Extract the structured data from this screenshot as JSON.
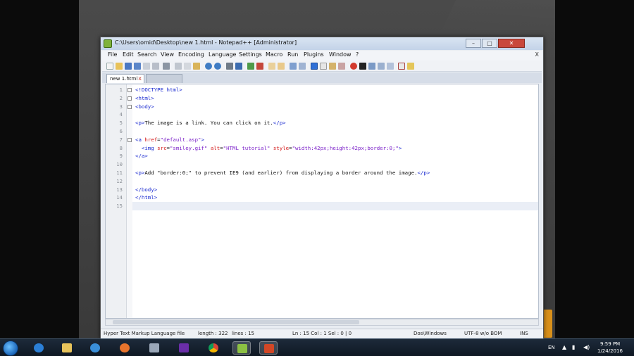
{
  "window": {
    "title": "C:\\Users\\omid\\Desktop\\new 1.html - Notepad++ [Administrator]",
    "controls": {
      "minimize": "–",
      "maximize": "□",
      "close": "✕"
    }
  },
  "menu": {
    "items": [
      "File",
      "Edit",
      "Search",
      "View",
      "Encoding",
      "Language",
      "Settings",
      "Macro",
      "Run",
      "Plugins",
      "Window",
      "?"
    ],
    "close": "X"
  },
  "tabs": [
    {
      "label": "new 1.html",
      "active": true,
      "close": "x"
    }
  ],
  "editor": {
    "lines": [
      {
        "n": "1",
        "code": "<!DOCTYPE html>"
      },
      {
        "n": "2",
        "code": "<html>"
      },
      {
        "n": "3",
        "code": "<body>"
      },
      {
        "n": "4",
        "code": ""
      },
      {
        "n": "5",
        "code": "<p>The image is a link. You can click on it.</p>"
      },
      {
        "n": "6",
        "code": ""
      },
      {
        "n": "7",
        "code": "<a href=\"default.asp\">"
      },
      {
        "n": "8",
        "code": "  <img src=\"smiley.gif\" alt=\"HTML tutorial\" style=\"width:42px;height:42px;border:0;\">"
      },
      {
        "n": "9",
        "code": "</a>"
      },
      {
        "n": "10",
        "code": ""
      },
      {
        "n": "11",
        "code": "<p>Add \"border:0;\" to prevent IE9 (and earlier) from displaying a border around the image.</p>"
      },
      {
        "n": "12",
        "code": ""
      },
      {
        "n": "13",
        "code": "</body>"
      },
      {
        "n": "14",
        "code": "</html>"
      },
      {
        "n": "15",
        "code": ""
      }
    ]
  },
  "status": {
    "doc_type": "Hyper Text Markup Language file",
    "length": "length : 322",
    "lines": "lines : 15",
    "position": "Ln : 15    Col : 1    Sel : 0 | 0",
    "eol": "Dos\\Windows",
    "encoding": "UTF-8 w/o BOM",
    "mode": "INS"
  },
  "taskbar": {
    "language": "EN",
    "time": "9:59 PM",
    "date": "1/24/2016",
    "apps": [
      "internet-explorer",
      "file-explorer",
      "media-player",
      "firefox",
      "control-panel",
      "visual-studio",
      "chrome",
      "notepad-plus-plus",
      "powerpoint"
    ]
  },
  "colors": {
    "tag": "#1a2ad0",
    "attribute": "#d21414",
    "string": "#7a1fc8",
    "text": "#111111"
  }
}
